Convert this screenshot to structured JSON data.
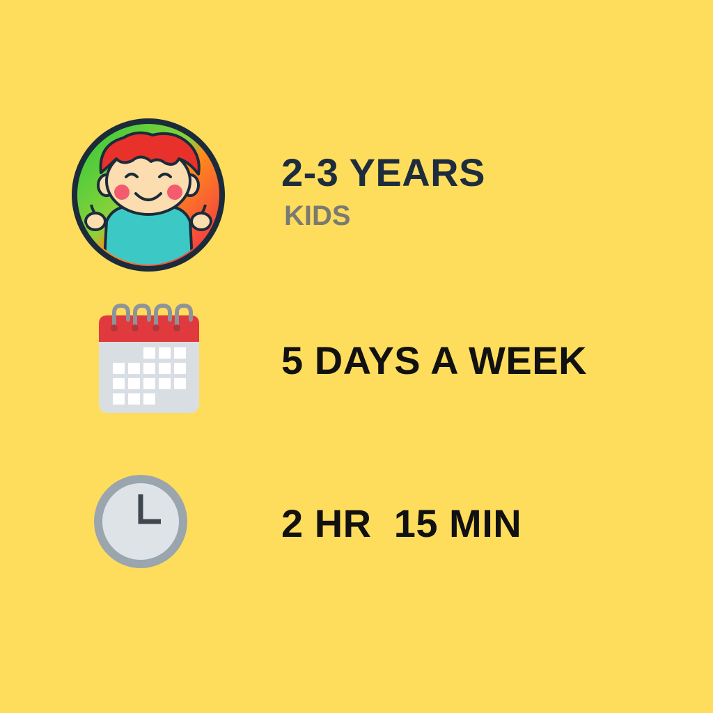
{
  "colors": {
    "background": "#FFDD5C",
    "age_title": "#1E2D3D",
    "age_subtitle": "#7A7A72",
    "detail_text": "#111111"
  },
  "items": [
    {
      "icon": "child-face-icon",
      "title": "2-3 YEARS",
      "subtitle": "KIDS"
    },
    {
      "icon": "calendar-icon",
      "title": "5 DAYS A WEEK"
    },
    {
      "icon": "clock-icon",
      "title": "2 HR  15 MIN"
    }
  ]
}
